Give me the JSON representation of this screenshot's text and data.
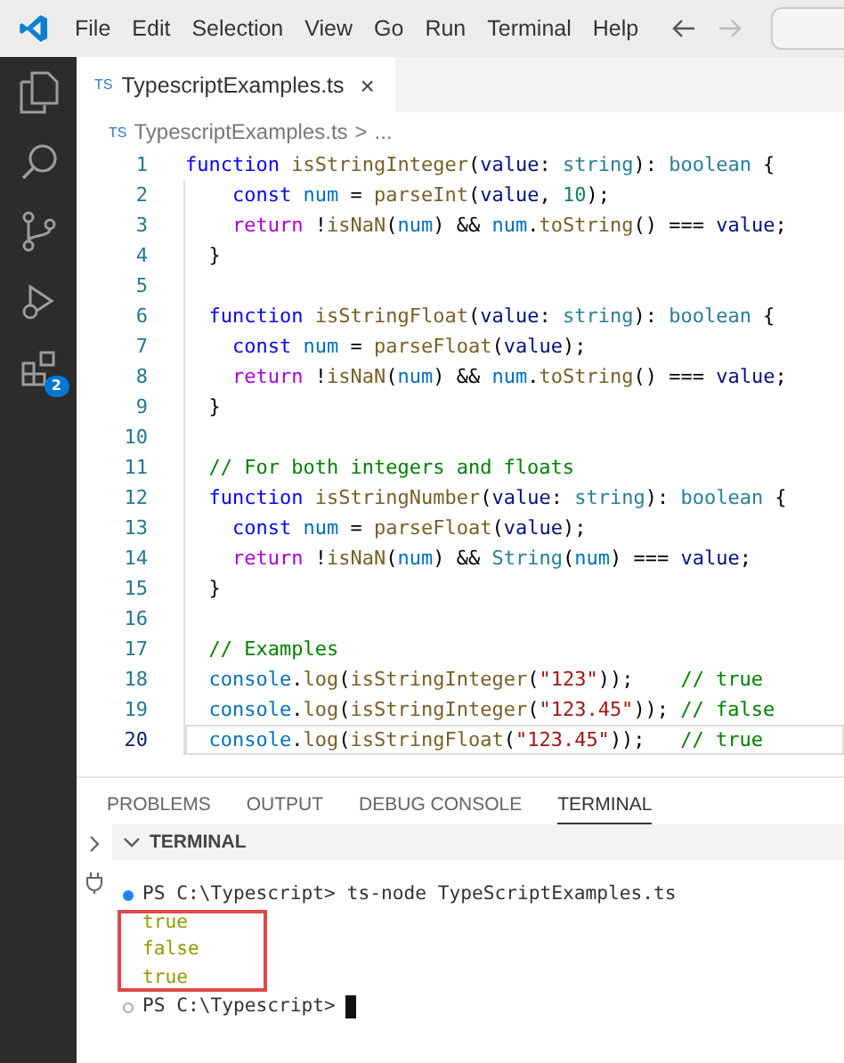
{
  "menu": [
    "File",
    "Edit",
    "Selection",
    "View",
    "Go",
    "Run",
    "Terminal",
    "Help"
  ],
  "activity": {
    "badge": "2"
  },
  "tabs": [
    {
      "icon": "TS",
      "label": "TypescriptExamples.ts",
      "close": "×",
      "selected": true
    }
  ],
  "breadcrumb": {
    "icon": "TS",
    "file": "TypescriptExamples.ts",
    "sep": ">",
    "rest": "..."
  },
  "editor": {
    "lines": [
      {
        "number": "1",
        "current": false,
        "tokens": [
          {
            "kind": "keyword",
            "text": "function"
          },
          {
            "kind": "function",
            "text": " isStringInteger"
          },
          {
            "kind": "plain",
            "text": "("
          },
          {
            "kind": "param",
            "text": "value"
          },
          {
            "kind": "plain",
            "text": ": "
          },
          {
            "kind": "type",
            "text": "string"
          },
          {
            "kind": "plain",
            "text": "): "
          },
          {
            "kind": "type",
            "text": "boolean"
          },
          {
            "kind": "plain",
            "text": " {"
          }
        ]
      },
      {
        "number": "2",
        "current": false,
        "tokens": [
          {
            "kind": "keyword",
            "text": "    const"
          },
          {
            "kind": "variable",
            "text": " num"
          },
          {
            "kind": "plain",
            "text": " = "
          },
          {
            "kind": "function",
            "text": "parseInt"
          },
          {
            "kind": "plain",
            "text": "("
          },
          {
            "kind": "param",
            "text": "value"
          },
          {
            "kind": "plain",
            "text": ", "
          },
          {
            "kind": "number",
            "text": "10"
          },
          {
            "kind": "plain",
            "text": ");"
          }
        ]
      },
      {
        "number": "3",
        "current": false,
        "tokens": [
          {
            "kind": "control",
            "text": "    return"
          },
          {
            "kind": "plain",
            "text": " !"
          },
          {
            "kind": "function",
            "text": "isNaN"
          },
          {
            "kind": "plain",
            "text": "("
          },
          {
            "kind": "variable",
            "text": "num"
          },
          {
            "kind": "plain",
            "text": ") && "
          },
          {
            "kind": "variable",
            "text": "num"
          },
          {
            "kind": "plain",
            "text": "."
          },
          {
            "kind": "function",
            "text": "toString"
          },
          {
            "kind": "plain",
            "text": "() === "
          },
          {
            "kind": "param",
            "text": "value"
          },
          {
            "kind": "plain",
            "text": ";"
          }
        ]
      },
      {
        "number": "4",
        "current": false,
        "tokens": [
          {
            "kind": "plain",
            "text": "  }"
          }
        ]
      },
      {
        "number": "5",
        "current": false
      },
      {
        "number": "6",
        "current": false,
        "tokens": [
          {
            "kind": "keyword",
            "text": "  function"
          },
          {
            "kind": "function",
            "text": " isStringFloat"
          },
          {
            "kind": "plain",
            "text": "("
          },
          {
            "kind": "param",
            "text": "value"
          },
          {
            "kind": "plain",
            "text": ": "
          },
          {
            "kind": "type",
            "text": "string"
          },
          {
            "kind": "plain",
            "text": "): "
          },
          {
            "kind": "type",
            "text": "boolean"
          },
          {
            "kind": "plain",
            "text": " {"
          }
        ]
      },
      {
        "number": "7",
        "current": false,
        "tokens": [
          {
            "kind": "keyword",
            "text": "    const"
          },
          {
            "kind": "variable",
            "text": " num"
          },
          {
            "kind": "plain",
            "text": " = "
          },
          {
            "kind": "function",
            "text": "parseFloat"
          },
          {
            "kind": "plain",
            "text": "("
          },
          {
            "kind": "param",
            "text": "value"
          },
          {
            "kind": "plain",
            "text": ");"
          }
        ]
      },
      {
        "number": "8",
        "current": false,
        "tokens": [
          {
            "kind": "control",
            "text": "    return"
          },
          {
            "kind": "plain",
            "text": " !"
          },
          {
            "kind": "function",
            "text": "isNaN"
          },
          {
            "kind": "plain",
            "text": "("
          },
          {
            "kind": "variable",
            "text": "num"
          },
          {
            "kind": "plain",
            "text": ") && "
          },
          {
            "kind": "variable",
            "text": "num"
          },
          {
            "kind": "plain",
            "text": "."
          },
          {
            "kind": "function",
            "text": "toString"
          },
          {
            "kind": "plain",
            "text": "() === "
          },
          {
            "kind": "param",
            "text": "value"
          },
          {
            "kind": "plain",
            "text": ";"
          }
        ]
      },
      {
        "number": "9",
        "current": false,
        "tokens": [
          {
            "kind": "plain",
            "text": "  }"
          }
        ]
      },
      {
        "number": "10",
        "current": false
      },
      {
        "number": "11",
        "current": false,
        "tokens": [
          {
            "kind": "comment",
            "text": "  // For both integers and floats"
          }
        ]
      },
      {
        "number": "12",
        "current": false,
        "tokens": [
          {
            "kind": "keyword",
            "text": "  function"
          },
          {
            "kind": "function",
            "text": " isStringNumber"
          },
          {
            "kind": "plain",
            "text": "("
          },
          {
            "kind": "param",
            "text": "value"
          },
          {
            "kind": "plain",
            "text": ": "
          },
          {
            "kind": "type",
            "text": "string"
          },
          {
            "kind": "plain",
            "text": "): "
          },
          {
            "kind": "type",
            "text": "boolean"
          },
          {
            "kind": "plain",
            "text": " {"
          }
        ]
      },
      {
        "number": "13",
        "current": false,
        "tokens": [
          {
            "kind": "keyword",
            "text": "    const"
          },
          {
            "kind": "variable",
            "text": " num"
          },
          {
            "kind": "plain",
            "text": " = "
          },
          {
            "kind": "function",
            "text": "parseFloat"
          },
          {
            "kind": "plain",
            "text": "("
          },
          {
            "kind": "param",
            "text": "value"
          },
          {
            "kind": "plain",
            "text": ");"
          }
        ]
      },
      {
        "number": "14",
        "current": false,
        "tokens": [
          {
            "kind": "control",
            "text": "    return"
          },
          {
            "kind": "plain",
            "text": " !"
          },
          {
            "kind": "function",
            "text": "isNaN"
          },
          {
            "kind": "plain",
            "text": "("
          },
          {
            "kind": "variable",
            "text": "num"
          },
          {
            "kind": "plain",
            "text": ") && "
          },
          {
            "kind": "type",
            "text": "String"
          },
          {
            "kind": "plain",
            "text": "("
          },
          {
            "kind": "variable",
            "text": "num"
          },
          {
            "kind": "plain",
            "text": ") === "
          },
          {
            "kind": "param",
            "text": "value"
          },
          {
            "kind": "plain",
            "text": ";"
          }
        ]
      },
      {
        "number": "15",
        "current": false,
        "tokens": [
          {
            "kind": "plain",
            "text": "  }"
          }
        ]
      },
      {
        "number": "16",
        "current": false
      },
      {
        "number": "17",
        "current": false,
        "tokens": [
          {
            "kind": "comment",
            "text": "  // Examples"
          }
        ]
      },
      {
        "number": "18",
        "current": false,
        "tokens": [
          {
            "kind": "variable",
            "text": "  console"
          },
          {
            "kind": "plain",
            "text": "."
          },
          {
            "kind": "function",
            "text": "log"
          },
          {
            "kind": "plain",
            "text": "("
          },
          {
            "kind": "function",
            "text": "isStringInteger"
          },
          {
            "kind": "plain",
            "text": "("
          },
          {
            "kind": "string",
            "text": "\"123\""
          },
          {
            "kind": "plain",
            "text": "));"
          },
          {
            "kind": "comment",
            "text": "    // true"
          }
        ]
      },
      {
        "number": "19",
        "current": false,
        "tokens": [
          {
            "kind": "variable",
            "text": "  console"
          },
          {
            "kind": "plain",
            "text": "."
          },
          {
            "kind": "function",
            "text": "log"
          },
          {
            "kind": "plain",
            "text": "("
          },
          {
            "kind": "function",
            "text": "isStringInteger"
          },
          {
            "kind": "plain",
            "text": "("
          },
          {
            "kind": "string",
            "text": "\"123.45\""
          },
          {
            "kind": "plain",
            "text": "));"
          },
          {
            "kind": "comment",
            "text": " // false"
          }
        ]
      },
      {
        "number": "20",
        "current": true,
        "tokens": [
          {
            "kind": "variable",
            "text": "  console"
          },
          {
            "kind": "plain",
            "text": "."
          },
          {
            "kind": "function",
            "text": "log"
          },
          {
            "kind": "plain",
            "text": "("
          },
          {
            "kind": "function",
            "text": "isStringFloat"
          },
          {
            "kind": "plain",
            "text": "("
          },
          {
            "kind": "string",
            "text": "\"123.45\""
          },
          {
            "kind": "plain",
            "text": "));"
          },
          {
            "kind": "comment",
            "text": "   // true"
          }
        ]
      }
    ]
  },
  "panel_tabs": [
    {
      "label": "PROBLEMS",
      "selected": false
    },
    {
      "label": "OUTPUT",
      "selected": false
    },
    {
      "label": "DEBUG CONSOLE",
      "selected": false
    },
    {
      "label": "TERMINAL",
      "selected": true
    }
  ],
  "terminal": {
    "header": "TERMINAL",
    "expanded": true,
    "lines": [
      {
        "kind": "prompt",
        "succeeded": true,
        "text": "PS C:\\Typescript>",
        "command": "ts-node TypeScriptExamples.ts"
      },
      {
        "kind": "output",
        "text": "true"
      },
      {
        "kind": "output",
        "text": "false"
      },
      {
        "kind": "output",
        "text": "true"
      },
      {
        "kind": "prompt",
        "succeeded": false,
        "text": "PS C:\\Typescript>"
      }
    ],
    "highlight": true
  }
}
